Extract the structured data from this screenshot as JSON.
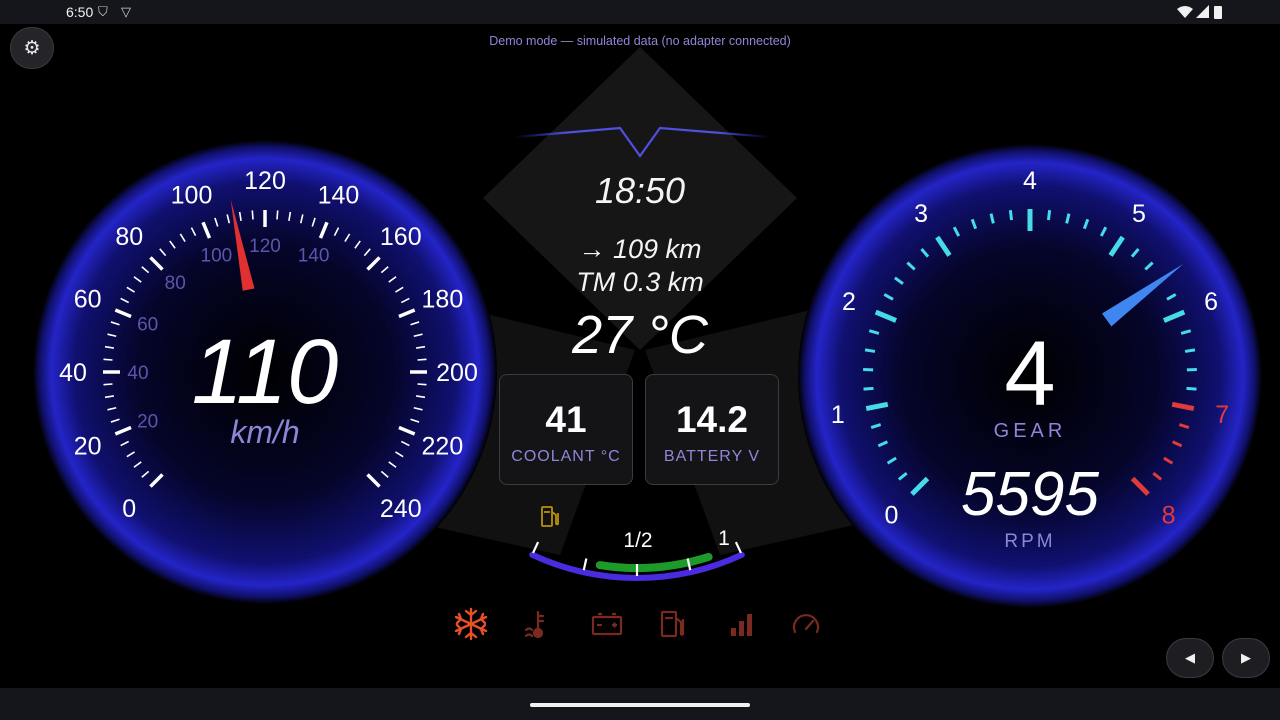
{
  "status_bar": {
    "time": "6:50",
    "left_icons": [
      "shield-icon",
      "vpn-icon"
    ],
    "right_icons": [
      "wifi-icon",
      "signal-icon",
      "battery-icon"
    ]
  },
  "demo_notice": "Demo mode — simulated data (no adapter connected)",
  "speedometer": {
    "value": "110",
    "unit": "km/h",
    "outer_labels": [
      "0",
      "20",
      "40",
      "60",
      "80",
      "100",
      "120",
      "140",
      "160",
      "180",
      "200",
      "220",
      "240"
    ],
    "inner_labels": [
      "20",
      "40",
      "60",
      "80",
      "100",
      "120",
      "140"
    ],
    "needle_value_kmh": 110,
    "needle_color": "#e03030",
    "accent_color": "#2a2ad8"
  },
  "center": {
    "clock": "18:50",
    "range": "→ 109 km",
    "trip": "TM 0.3 km",
    "outside_temp": "27 °C"
  },
  "cards": {
    "coolant": {
      "value": "41",
      "label": "COOLANT °C"
    },
    "battery": {
      "value": "14.2",
      "label": "BATTERY V"
    }
  },
  "fuel_gauge": {
    "half_label": "1/2",
    "full_label": "1",
    "level": 0.85,
    "icon": "fuel-pump-icon",
    "bar_color": "#1e9a2a",
    "track_color": "#4a2be0"
  },
  "tachometer": {
    "labels": [
      "0",
      "1",
      "2",
      "3",
      "4",
      "5",
      "6",
      "7",
      "8"
    ],
    "redline_from": 7,
    "needle_rpm": 5595,
    "tick_color": "#45dbe8",
    "redline_color": "#e03a3a",
    "needle_color": "#3f86f0"
  },
  "gear": {
    "value": "4",
    "label": "GEAR"
  },
  "rpm": {
    "value": "5595",
    "label": "RPM"
  },
  "warning_icons": [
    {
      "name": "ac-snowflake-icon",
      "color": "#e8502a",
      "active": true
    },
    {
      "name": "coolant-temp-icon",
      "color": "#7a2a1e",
      "active": false
    },
    {
      "name": "battery-warning-icon",
      "color": "#7a2a1e",
      "active": false
    },
    {
      "name": "low-fuel-icon",
      "color": "#7a2a1e",
      "active": false
    },
    {
      "name": "signal-bars-icon",
      "color": "#7a2a1e",
      "active": false
    },
    {
      "name": "speedometer-icon",
      "color": "#7a2a1e",
      "active": false
    }
  ],
  "controls": {
    "settings_icon": "⚙",
    "prev_label": "◀",
    "next_label": "▶"
  }
}
